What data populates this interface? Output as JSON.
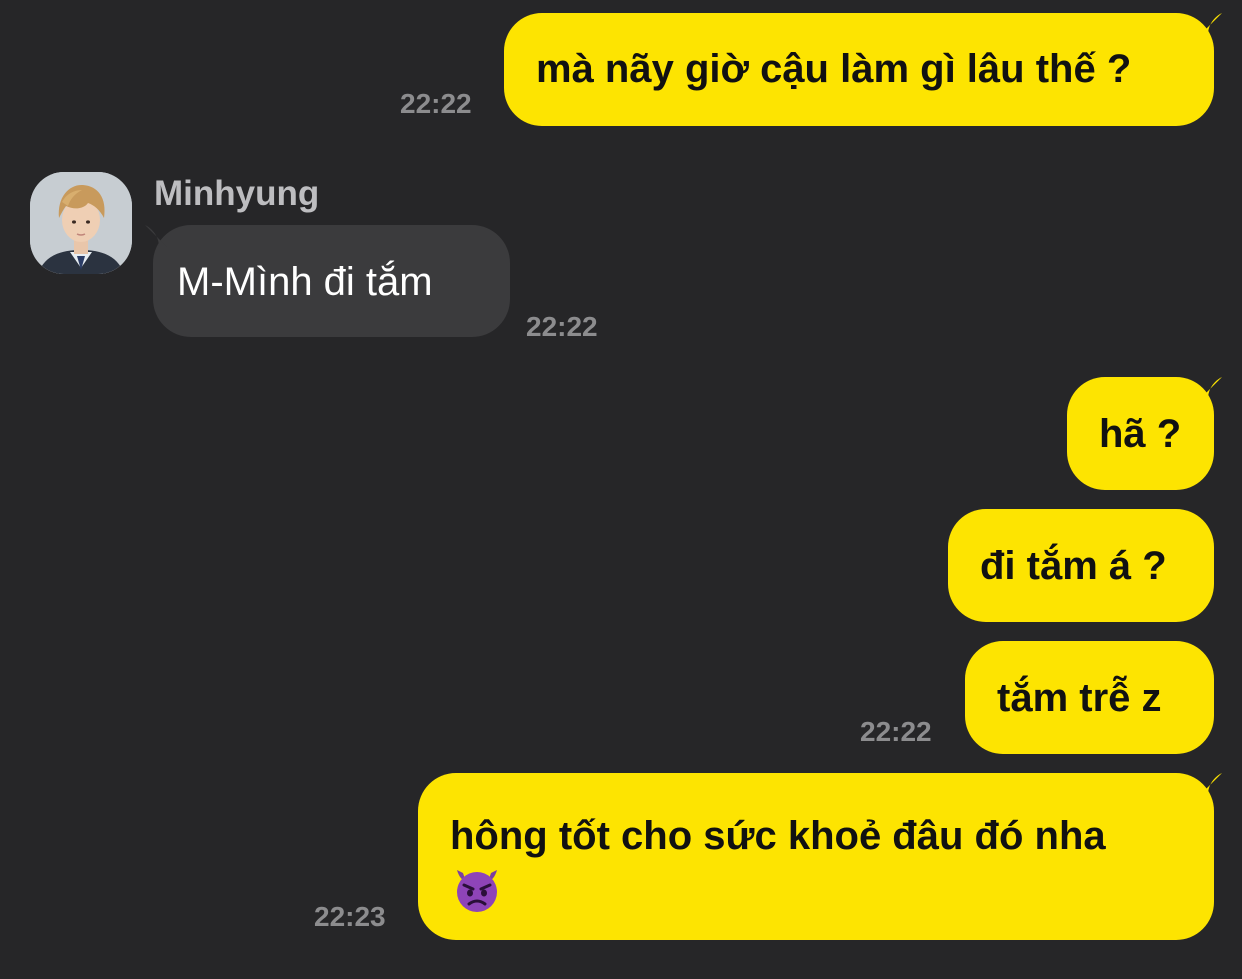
{
  "chat": {
    "sender_name": "Minhyung",
    "messages": [
      {
        "id": "m1",
        "direction": "outgoing",
        "text": "mà nãy giờ cậu làm gì lâu thế ?",
        "time": "22:22"
      },
      {
        "id": "m2",
        "direction": "incoming",
        "text": "M-Mình đi tắm",
        "time": "22:22"
      },
      {
        "id": "m3",
        "direction": "outgoing",
        "text": "hã ?"
      },
      {
        "id": "m4",
        "direction": "outgoing",
        "text": "đi tắm á ?"
      },
      {
        "id": "m5",
        "direction": "outgoing",
        "text": "tắm trễ z",
        "time": "22:22"
      },
      {
        "id": "m6",
        "direction": "outgoing",
        "text": "hông tốt cho sức khoẻ đâu đó nha",
        "emoji": "angry-devil-emoji",
        "time": "22:23"
      }
    ]
  },
  "colors": {
    "background": "#262628",
    "outgoing_bubble": "#FDE401",
    "incoming_bubble": "#3B3B3D",
    "timestamp": "#8C8C8E",
    "sender_name": "#BDBDC0"
  }
}
